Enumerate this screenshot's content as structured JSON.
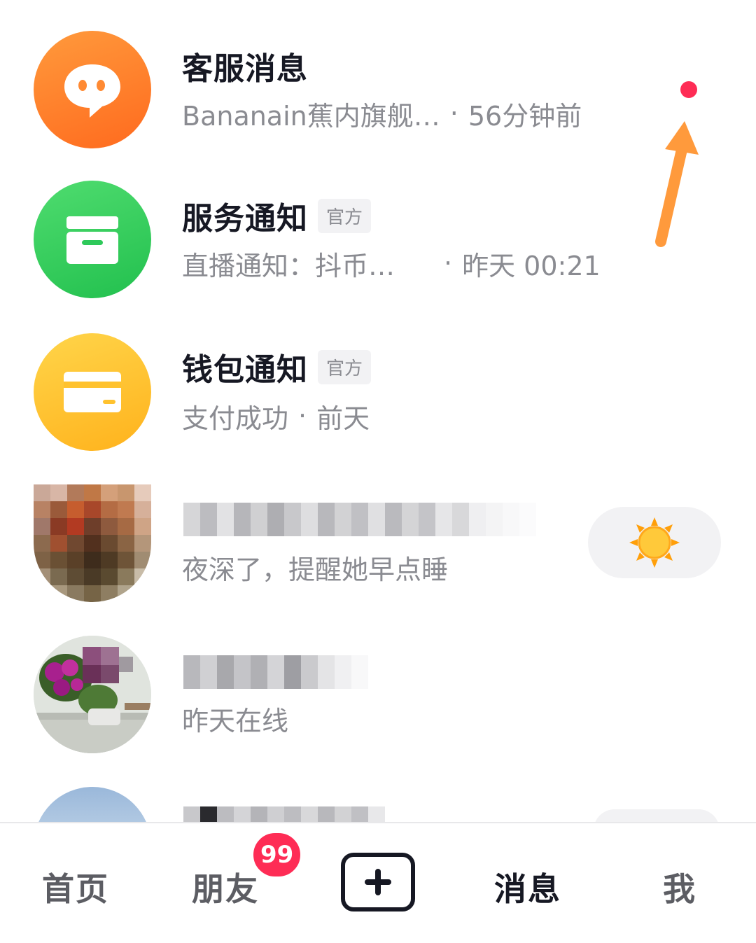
{
  "conversations": [
    {
      "title": "客服消息",
      "tag": "",
      "preview": "Bananain蕉内旗舰…",
      "time": "56分钟前",
      "avatar_icon": "chat-bubble-icon",
      "avatar_color": "#ff7a26",
      "unread_dot": true
    },
    {
      "title": "服务通知",
      "tag": "官方",
      "preview": "直播通知：抖币…",
      "time": "昨天 00:21",
      "avatar_icon": "inbox-icon",
      "avatar_color": "#2ec95a"
    },
    {
      "title": "钱包通知",
      "tag": "官方",
      "preview": "支付成功",
      "time": "前天",
      "avatar_icon": "card-icon",
      "avatar_color": "#ffc22e"
    },
    {
      "title": "",
      "preview": "夜深了，提醒她早点睡",
      "action_icon": "sun-icon"
    },
    {
      "title": "",
      "preview": "昨天在线"
    }
  ],
  "tabbar": {
    "home": "首页",
    "friends": "朋友",
    "friends_badge": "99",
    "create_icon": "plus-icon",
    "messages": "消息",
    "me": "我"
  },
  "colors": {
    "accent": "#fe2c55",
    "annotation_arrow": "#ff9a3c"
  }
}
